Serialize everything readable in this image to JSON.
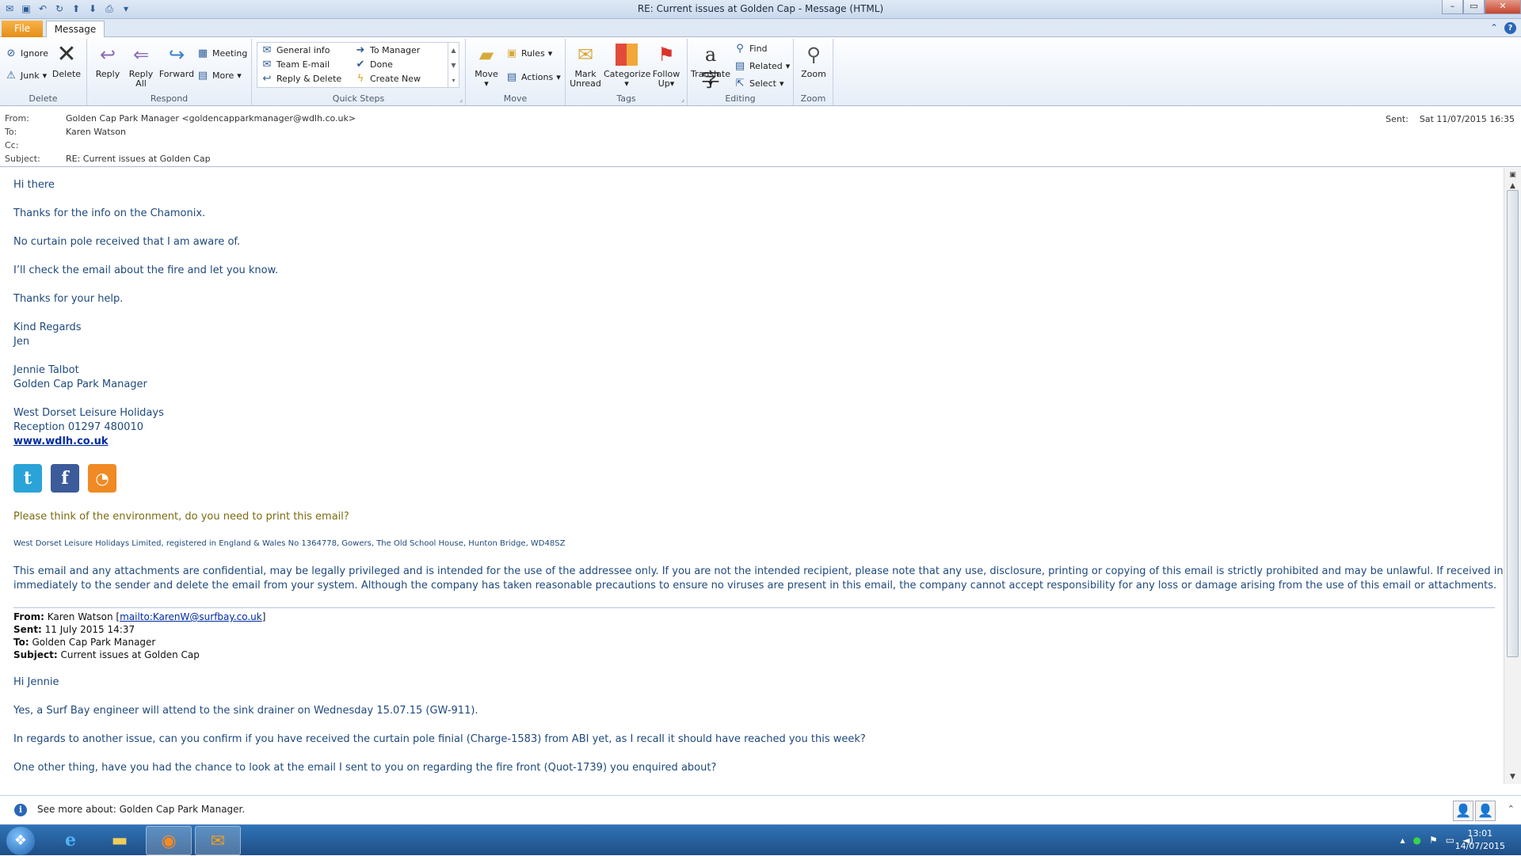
{
  "window": {
    "title": "RE: Current issues at Golden Cap  -  Message (HTML)"
  },
  "tabs": {
    "file": "File",
    "message": "Message"
  },
  "ribbon": {
    "delete": {
      "ignore": "Ignore",
      "junk": "Junk",
      "delete": "Delete",
      "label": "Delete"
    },
    "respond": {
      "reply": "Reply",
      "reply_all_1": "Reply",
      "reply_all_2": "All",
      "forward": "Forward",
      "meeting": "Meeting",
      "more": "More",
      "label": "Respond"
    },
    "quick_steps": {
      "items": [
        "General info",
        "To Manager",
        "Team E-mail",
        "Done",
        "Reply & Delete",
        "Create New"
      ],
      "label": "Quick Steps"
    },
    "move": {
      "move": "Move",
      "rules": "Rules",
      "actions": "Actions",
      "label": "Move"
    },
    "tags": {
      "mark_1": "Mark",
      "mark_2": "Unread",
      "categorize": "Categorize",
      "follow_1": "Follow",
      "follow_2": "Up",
      "label": "Tags"
    },
    "editing": {
      "translate": "Translate",
      "find": "Find",
      "related": "Related",
      "select": "Select",
      "label": "Editing"
    },
    "zoom": {
      "zoom": "Zoom",
      "label": "Zoom"
    }
  },
  "header": {
    "from_label": "From:",
    "from": "Golden Cap Park Manager <goldencapparkmanager@wdlh.co.uk>",
    "to_label": "To:",
    "to": "Karen Watson",
    "cc_label": "Cc:",
    "cc": "",
    "subject_label": "Subject:",
    "subject": "RE: Current issues at Golden Cap",
    "sent_label": "Sent:",
    "sent": "Sat 11/07/2015 16:35"
  },
  "body": {
    "greeting": "Hi there",
    "line1": "Thanks for the info on the Chamonix.",
    "line2": "No curtain pole received that I am aware of.",
    "line3": "I’ll check the email about the fire and let you know.",
    "line4": "Thanks for your help.",
    "regards": "Kind Regards",
    "sig_short": "Jen",
    "sig_name": "Jennie Talbot",
    "sig_title": "Golden Cap Park Manager",
    "company": "West Dorset Leisure Holidays",
    "reception": "Reception 01297 480010",
    "website": "www.wdlh.co.uk",
    "env": "Please think of the environment, do you need to print this email?",
    "registered": "West Dorset Leisure Holidays Limited, registered in England & Wales No 1364778, Gowers, The Old School House, Hunton Bridge, WD48SZ",
    "disclaimer1": "This email and any attachments are confidential, may be legally privileged and is intended for the use of the addressee only. If you are not the intended recipient, please note that any use, disclosure, printing or copying of this email is strictly prohibited and may be unlawful. If received in error, please return",
    "disclaimer2": "immediately to the sender and delete the email from your system. Although the company has taken reasonable precautions to ensure no viruses are present in this email, the company cannot accept responsibility for any loss or damage arising from the use of this email or attachments."
  },
  "quoted": {
    "from_label": "From:",
    "from": " Karen Watson [",
    "mailto": "mailto:KarenW@surfbay.co.uk",
    "from_end": "]",
    "sent_label": "Sent:",
    "sent": " 11 July 2015 14:37",
    "to_label": "To:",
    "to": " Golden Cap Park Manager",
    "subject_label": "Subject:",
    "subject": " Current issues at Golden Cap",
    "greeting": "Hi Jennie",
    "line1": "Yes, a Surf Bay engineer will attend to the sink drainer on Wednesday 15.07.15 (GW-911).",
    "line2": "In regards to another issue, can you confirm if you have received the curtain pole finial (Charge-1583) from ABI yet, as I recall it should have reached you this week?",
    "line3": "One other thing, have you had the chance to look at the email I sent to you on regarding the fire front (Quot-1739) you enquired about?"
  },
  "people_pane": {
    "text": "See more about: Golden Cap Park Manager."
  },
  "taskbar": {
    "time": "13:01",
    "date": "14/07/2015"
  },
  "colors": {
    "file_tab": "#e58e16",
    "body_text": "#1f497d",
    "link": "#002ba2",
    "taskbar": "#1f4e86"
  }
}
